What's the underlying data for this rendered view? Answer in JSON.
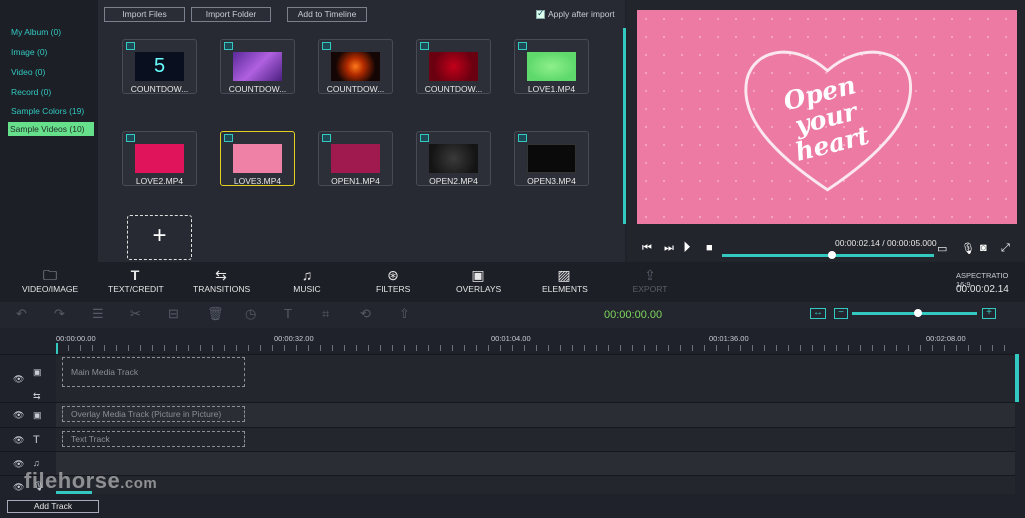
{
  "sidebar": {
    "items": [
      {
        "label": "My Album (0)"
      },
      {
        "label": "Image (0)"
      },
      {
        "label": "Video (0)"
      },
      {
        "label": "Record (0)"
      },
      {
        "label": "Sample Colors (19)"
      },
      {
        "label": "Sample Videos (10)",
        "active": true
      }
    ]
  },
  "media": {
    "import_files": "Import Files",
    "import_folder": "Import Folder",
    "add_to_timeline": "Add to Timeline",
    "apply_after_import": "Apply after import",
    "apply_checked": true,
    "thumbnails": [
      {
        "label": "COUNTDOW..."
      },
      {
        "label": "COUNTDOW..."
      },
      {
        "label": "COUNTDOW..."
      },
      {
        "label": "COUNTDOW..."
      },
      {
        "label": "LOVE1.MP4"
      },
      {
        "label": "LOVE2.MP4"
      },
      {
        "label": "LOVE3.MP4",
        "selected": true
      },
      {
        "label": "OPEN1.MP4"
      },
      {
        "label": "OPEN2.MP4"
      },
      {
        "label": "OPEN3.MP4"
      }
    ],
    "add_icon": "+"
  },
  "preview": {
    "overlay_line1": "Open",
    "overlay_line2": "your",
    "overlay_line3": "heart",
    "timecode": "00:00:02.14 / 00:00:05.000",
    "progress_fraction": 0.52
  },
  "toolbar": {
    "tools": [
      {
        "label": "VIDEO/IMAGE",
        "icon": "folder-icon"
      },
      {
        "label": "TEXT/CREDIT",
        "icon": "text-icon"
      },
      {
        "label": "TRANSITIONS",
        "icon": "transitions-icon"
      },
      {
        "label": "MUSIC",
        "icon": "music-icon"
      },
      {
        "label": "FILTERS",
        "icon": "filters-icon"
      },
      {
        "label": "OVERLAYS",
        "icon": "overlays-icon"
      },
      {
        "label": "ELEMENTS",
        "icon": "elements-icon"
      },
      {
        "label": "EXPORT",
        "icon": "export-icon",
        "disabled": true
      }
    ],
    "aspect_ratio": "ASPECTRATIO 16:9",
    "current_time": "00:00:02.14"
  },
  "editbar": {
    "time": "00:00:00.00",
    "zoom_fraction": 0.53
  },
  "ruler": {
    "ticks": [
      "00:00:00.00",
      "00:00:32.00",
      "00:01:04.00",
      "00:01:36.00",
      "00:02:08.00"
    ]
  },
  "tracks": {
    "main": "Main Media Track",
    "overlay": "Overlay Media Track (Picture in Picture)",
    "text": "Text Track",
    "add_track": "Add Track"
  },
  "watermark": {
    "text": "filehorse",
    "suffix": ".com"
  },
  "colors": {
    "accent": "#33c8c0",
    "active_sidebar": "#66e08a",
    "preview_bg": "#ed7aa2",
    "time_green": "#7ed65c",
    "selected_border": "#e5d021"
  }
}
